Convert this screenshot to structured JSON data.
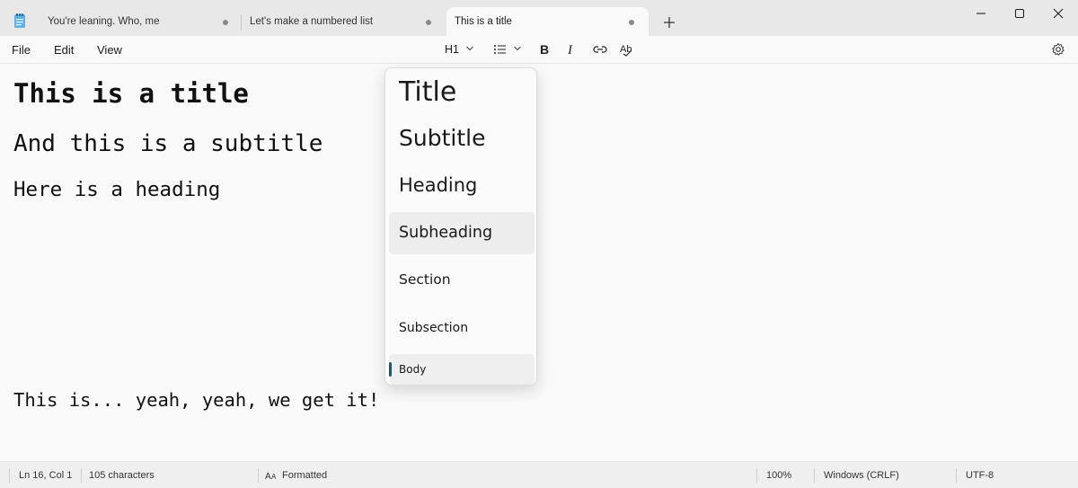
{
  "tabs": [
    {
      "label": "You're leaning. Who, me",
      "state": "inactive",
      "unsaved": true
    },
    {
      "label": "Let's make a numbered list",
      "state": "inactive",
      "unsaved": true
    },
    {
      "label": "This is a title",
      "state": "active",
      "unsaved": true
    }
  ],
  "menu": {
    "file": "File",
    "edit": "Edit",
    "view": "View"
  },
  "toolbar": {
    "heading_level": "H1"
  },
  "document": {
    "title": "This is a title",
    "subtitle": "And this is a subtitle",
    "heading": "Here is a heading",
    "body": "This is... yeah, yeah, we get it!"
  },
  "dropdown": {
    "items": [
      {
        "label": "Title"
      },
      {
        "label": "Subtitle"
      },
      {
        "label": "Heading"
      },
      {
        "label": "Subheading",
        "state": "hover"
      },
      {
        "label": "Section"
      },
      {
        "label": "Subsection"
      },
      {
        "label": "Body",
        "state": "selected"
      }
    ]
  },
  "status": {
    "position": "Ln 16, Col 1",
    "characters": "105 characters",
    "format": "Formatted",
    "zoom": "100%",
    "line_ending": "Windows (CRLF)",
    "encoding": "UTF-8"
  },
  "colors": {
    "accent": "#115e73",
    "titlebar": "#e8e8e8",
    "background": "#f9f9f9"
  }
}
